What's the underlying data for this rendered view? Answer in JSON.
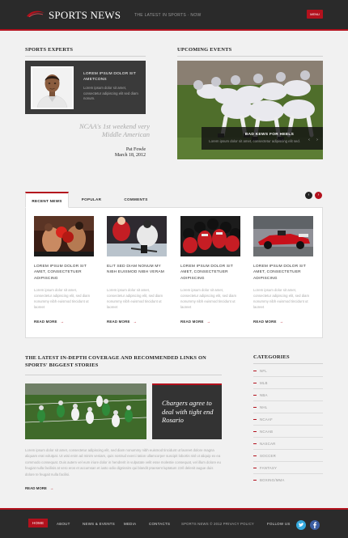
{
  "header": {
    "logo": "SPORTS NEWS",
    "tagline": "THE LATEST IN SPORTS · NOW",
    "menu_label": "MENU"
  },
  "experts": {
    "heading": "SPORTS EXPERTS",
    "name": "LOREM IPSUM DOLOR SIT AMETCONS",
    "text": "Lorem ipsum dolor sit amet, consectetur adipiscing elit sed diam nonum.",
    "quote": "NCAA's 1st weekend very Middle American",
    "author": "Pat Fowle",
    "date": "March 18, 2012"
  },
  "events": {
    "heading": "UPCOMING EVENTS",
    "caption_title": "BAD KEWS FOR HEELS",
    "caption_text": "Lorem ipsum dolor sit amet, consectetur adipiscing elit sed.",
    "prev_icon": "‹",
    "next_icon": "›"
  },
  "tabs": {
    "items": [
      "RECENT NEWS",
      "POPULAR",
      "COMMENTS"
    ],
    "active_index": 0,
    "prev_icon": "‹",
    "next_icon": "›"
  },
  "news": [
    {
      "title": "LOREM IPSUM DOLOR SIT AMET, CONSECTETUER ADIPISCING",
      "text": "Lorem ipsum dolor sit amet, consectetur adipiscing elit, sed diam nonummy nibh euismod tincidunt ut laoreet",
      "more": "READ MORE"
    },
    {
      "title": "ELIT SED DIAM NONUM MY NIBH EUISMOD NIBH VERAM",
      "text": "Lorem ipsum dolor sit amet, consectetur adipiscing elit, sed diam nonummy nibh euismod tincidunt ut laoreet",
      "more": "READ MORE"
    },
    {
      "title": "LOREM IPSUM DOLOR SIT AMET, CONSECTETUER ADIPISCING",
      "text": "Lorem ipsum dolor sit amet, consectetur adipiscing elit, sed diam nonummy nibh euismod tincidunt ut laoreet",
      "more": "READ MORE"
    },
    {
      "title": "LOREM IPSUM DOLOR SIT AMET, CONSECTETUER ADIPISCING",
      "text": "Lorem ipsum dolor sit amet, consectetur adipiscing elit, sed diam nonummy nibh euismod tincidunt ut laoreet",
      "more": "READ MORE"
    }
  ],
  "coverage": {
    "heading": "THE LATEST IN-DEPTH COVERAGE AND RECOMMENDED LINKS ON SPORTS' BIGGEST STORIES",
    "card_text": "Chargers agree to deal with tight end Rosario",
    "paragraph": "Lorem ipsum dolor sit amet, consectetur adipiscing elit, sed diam nonummy nibh euismod tincidunt ut laoreet dolore magna aliquam erat volutpat. Ut wisi enim ad minim veniam, quis nostrud exerci tation ullamcorper suscipit lobortis nisl ut aliquip ex ea commodo consequat. Duis autem vel eum iriure dolor in hendrerit in vulputate velit esse molestie consequat, vel illum dolore eu feugiat nulla facilisis at vero eros et accumsan et iusto odio dignissim qui blandit praesent luptatum zzril delenit augue duis dolore te feugait nulla facilisi.",
    "more": "READ MORE"
  },
  "categories": {
    "heading": "CATEGORIES",
    "items": [
      "NFL",
      "MLB",
      "NBA",
      "NHL",
      "NCAAF",
      "NCAAB",
      "NASCAR",
      "SOCCER",
      "FANTASY",
      "BOXING/MMA"
    ]
  },
  "footer": {
    "nav": [
      "HOME",
      "ABOUT",
      "NEWS & EVENTS",
      "MEDIA",
      "CONTACTS"
    ],
    "copyright": "SPORTS NEWS © 2012 PRIVACY POLICY",
    "follow": "FOLLOW US",
    "social": [
      "twitter-icon",
      "facebook-icon"
    ]
  },
  "colors": {
    "accent": "#b3111d",
    "dark": "#2a2a2a",
    "twitter": "#35a8dc",
    "facebook": "#3b5ea3"
  }
}
